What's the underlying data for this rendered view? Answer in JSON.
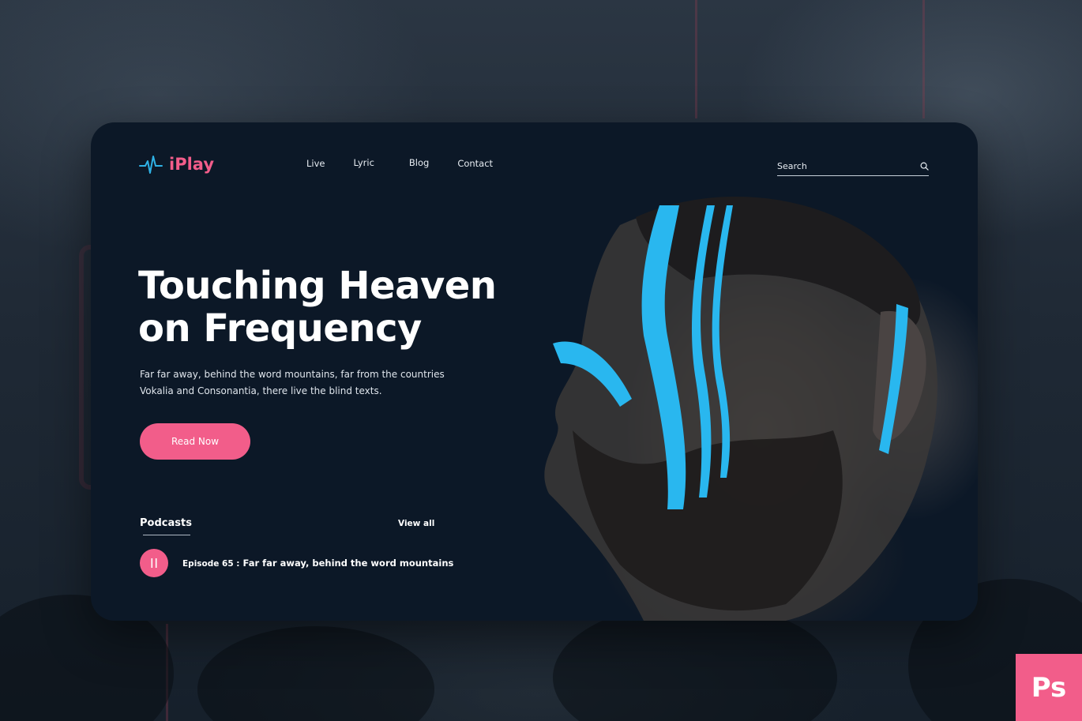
{
  "brand": {
    "name": "iPlay",
    "accent": "#f25d8a",
    "logo_icon": "pulse-wave-icon",
    "logo_icon_color": "#2fb2e6"
  },
  "nav": {
    "items": [
      {
        "label": "Live"
      },
      {
        "label": "Lyric"
      },
      {
        "label": "Blog"
      },
      {
        "label": "Contact"
      }
    ]
  },
  "search": {
    "placeholder": "Search",
    "icon": "search-icon"
  },
  "hero": {
    "title_line1": "Touching Heaven",
    "title_line2": "on Frequency",
    "desc_line1": "Far far away, behind the word mountains, far from the countries",
    "desc_line2": "Vokalia and Consonantia, there live the blind texts.",
    "cta_label": "Read Now",
    "image": "portrait-with-blue-face-paint"
  },
  "podcasts": {
    "title": "Podcasts",
    "view_all": "View all",
    "episode": {
      "number_label": "Episode 65 :",
      "title": "Far far away, behind the word mountains",
      "control_icon": "pause-icon"
    }
  },
  "badge": {
    "label": "Ps"
  },
  "colors": {
    "card_bg": "#0c1827",
    "page_bg": "#1c2633",
    "face_paint": "#29b7ef"
  }
}
